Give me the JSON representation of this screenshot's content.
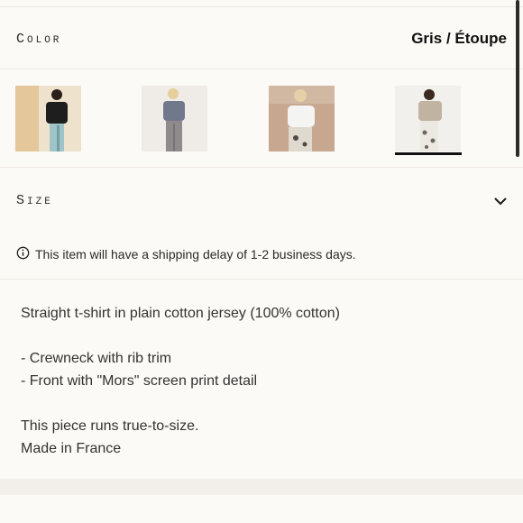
{
  "color_section": {
    "label": "Color",
    "selected_value": "Gris / Étoupe",
    "swatches": [
      {
        "name": "black-tshirt-swatch",
        "shirt": "#1e1e1e",
        "pants": "#9fc3c6",
        "bg": "#efe2cc"
      },
      {
        "name": "grey-tshirt-swatch",
        "shirt": "#72788c",
        "pants": "#8f8a8c",
        "bg": "#efebe6"
      },
      {
        "name": "white-tshirt-swatch",
        "shirt": "#f4f4f2",
        "pants": "#e0d9cf",
        "bg": "#c7a78f"
      },
      {
        "name": "taupe-tshirt-swatch",
        "shirt": "#c1b3a1",
        "pants": "#ece9e3",
        "bg": "#f2f0ec",
        "selected": true
      }
    ]
  },
  "size_section": {
    "label": "Size",
    "chevron_icon": "chevron-down-icon"
  },
  "shipping_notice": {
    "icon": "info-icon",
    "text": "This item will have a shipping delay of 1-2 business days."
  },
  "description": {
    "line1": "Straight t-shirt in plain cotton jersey (100% cotton)",
    "bullet1": "- Crewneck with rib trim",
    "bullet2": "- Front with \"Mors\" screen print detail",
    "fit": "This piece runs true-to-size.",
    "origin": "Made in France"
  },
  "colors": {
    "background": "#fcfaf6",
    "divider": "#ece8e1",
    "text": "#1c1c1c",
    "selected_underline": "#111111"
  }
}
